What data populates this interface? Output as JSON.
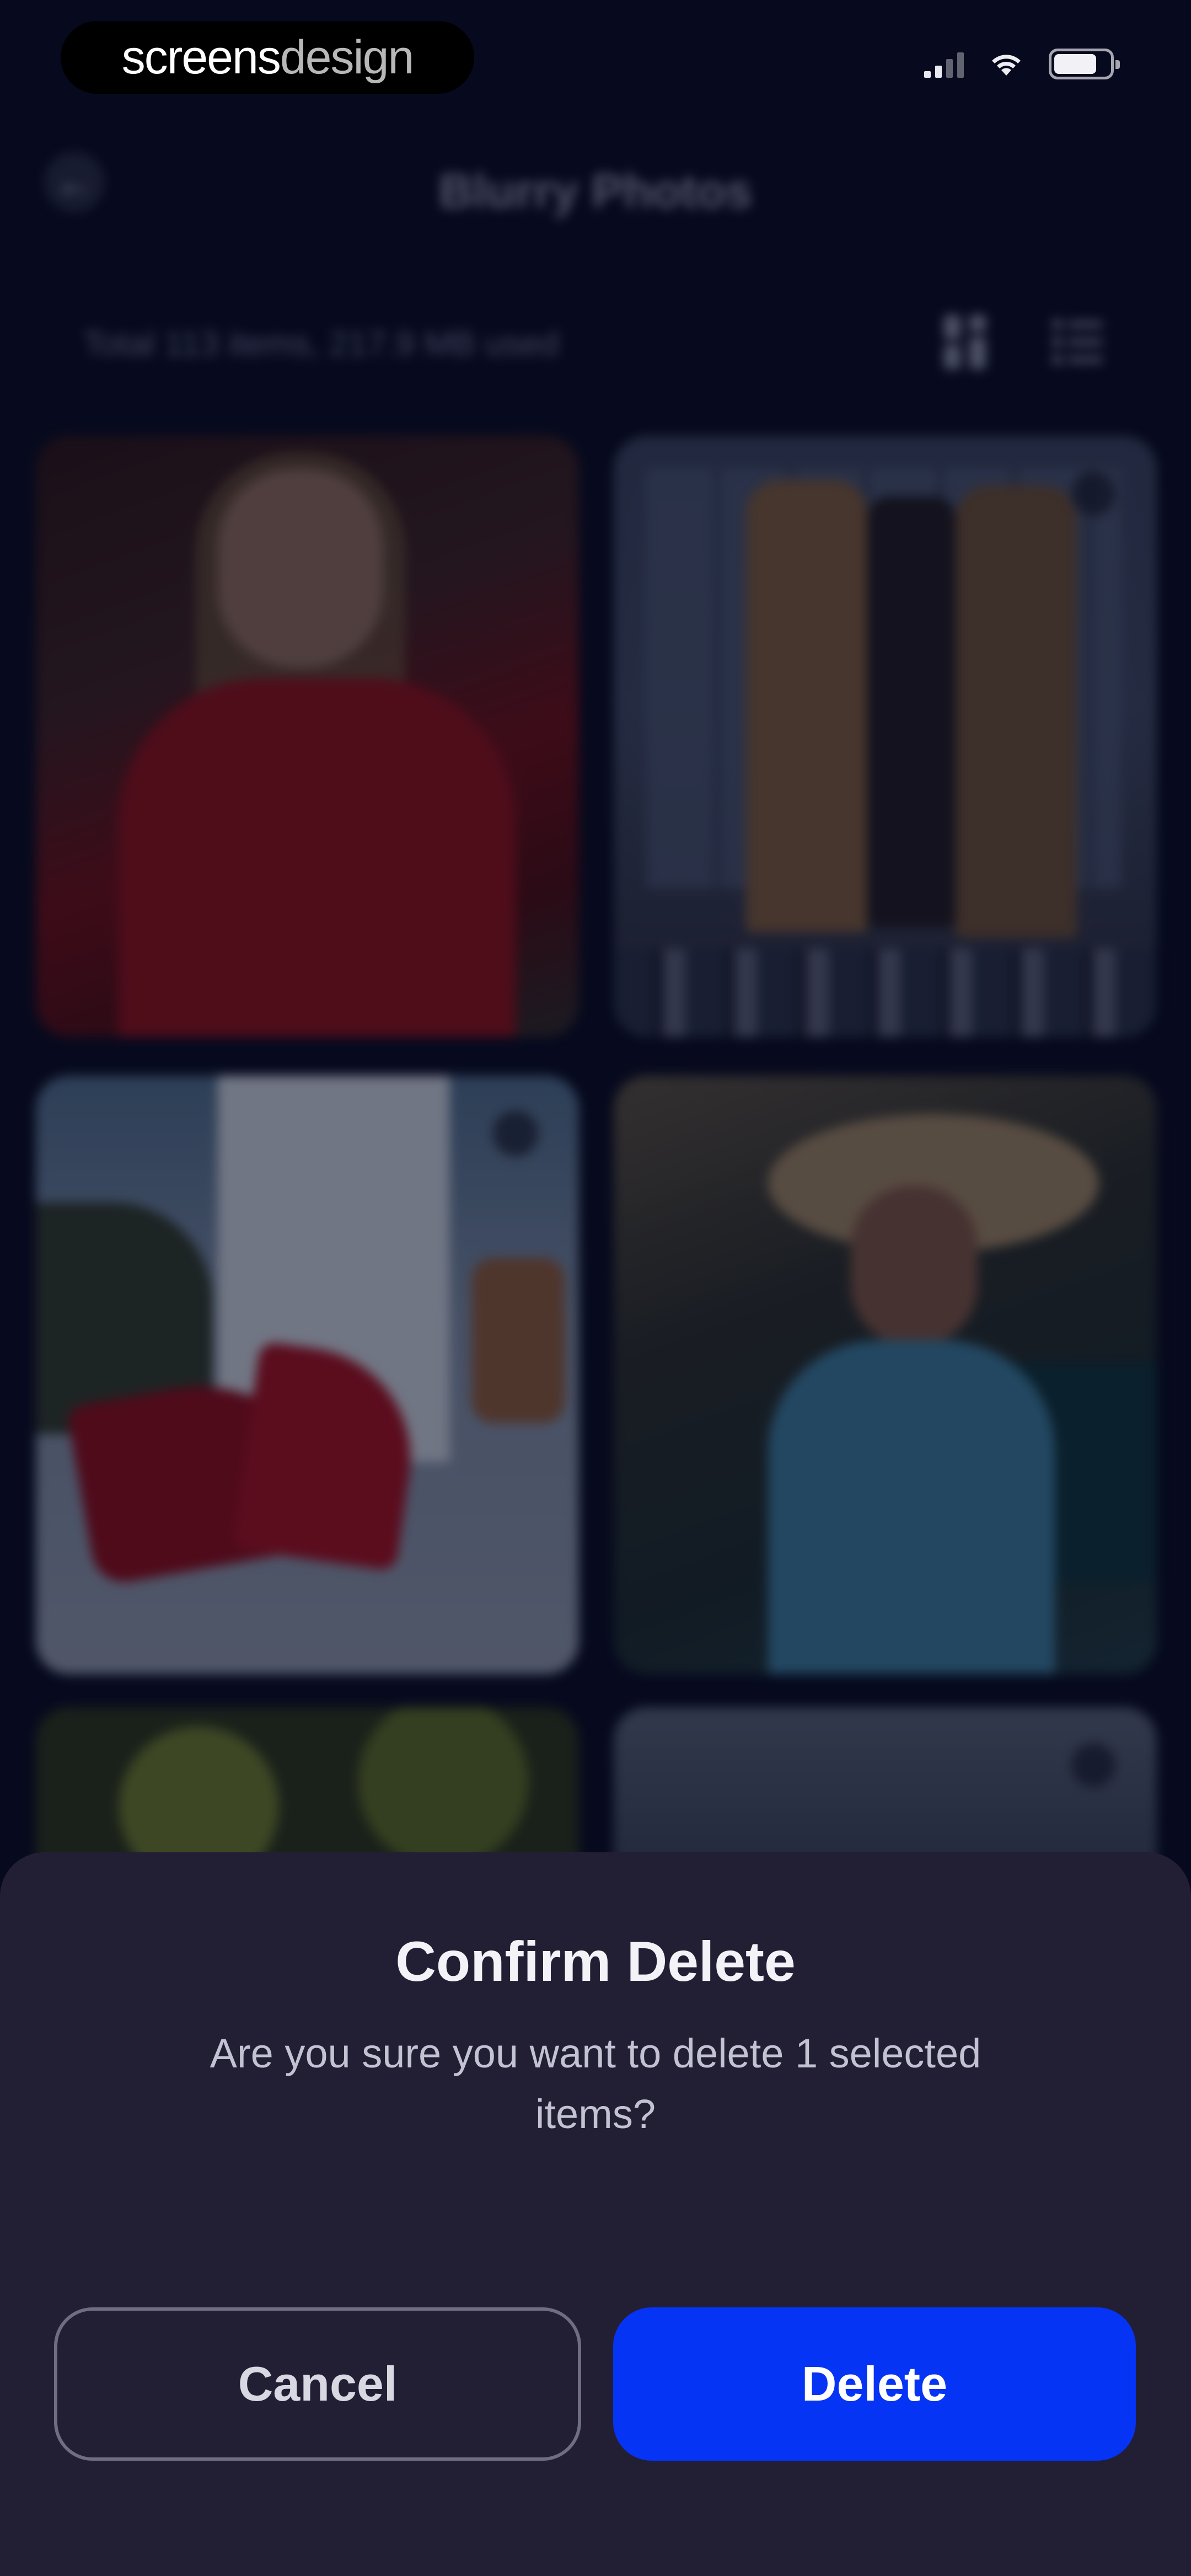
{
  "status_bar": {
    "watermark_bold": "screens",
    "watermark_light": "design",
    "icons": [
      "cellular-signal-icon",
      "wifi-icon",
      "battery-icon"
    ]
  },
  "header": {
    "title": "Blurry Photos",
    "back_icon": "arrow-left-icon"
  },
  "summary": {
    "text": "Total 113 items, 217.9 MB used"
  },
  "view_controls": [
    "grid-view-icon",
    "list-view-icon"
  ],
  "photos": [
    {
      "subject": "woman in red coat",
      "selected_indicator": false
    },
    {
      "subject": "coats on rack",
      "selected_indicator": true
    },
    {
      "subject": "red high heels",
      "selected_indicator": true
    },
    {
      "subject": "woman in sun hat",
      "selected_indicator": false
    },
    {
      "subject": "green fruit",
      "selected_indicator": false
    },
    {
      "subject": "landscape",
      "selected_indicator": true
    }
  ],
  "dialog": {
    "title": "Confirm Delete",
    "message": "Are you sure you want to delete 1 selected items?",
    "cancel_label": "Cancel",
    "delete_label": "Delete"
  },
  "colors": {
    "background": "#070a1e",
    "sheet": "#221f35",
    "delete_accent": "#0634f5"
  }
}
